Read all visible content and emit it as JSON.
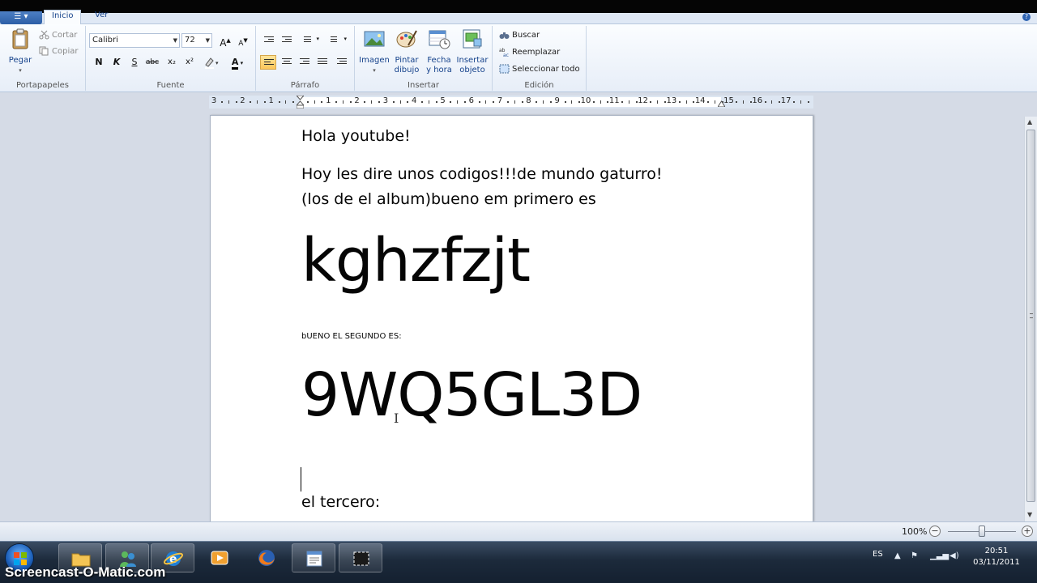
{
  "tabs": [
    {
      "label": "Inicio",
      "active": true
    },
    {
      "label": "Ver",
      "active": false
    }
  ],
  "clipboard": {
    "paste_label": "Pegar",
    "cut_label": "Cortar",
    "copy_label": "Copiar",
    "group_label": "Portapapeles"
  },
  "font": {
    "family": "Calibri",
    "size": "72",
    "bold": "N",
    "italic": "K",
    "underline": "S",
    "strike": "abc",
    "subscript": "x₂",
    "superscript": "x²",
    "color_letter": "A",
    "grow_letter": "A",
    "shrink_letter": "A",
    "group_label": "Fuente"
  },
  "paragraph": {
    "group_label": "Párrafo"
  },
  "insert": {
    "image_label": "Imagen",
    "paint_label": "Pintar dibujo",
    "paint_line1": "Pintar",
    "paint_line2": "dibujo",
    "date_line1": "Fecha",
    "date_line2": "y hora",
    "object_line1": "Insertar",
    "object_line2": "objeto",
    "group_label": "Insertar"
  },
  "editing": {
    "find_label": "Buscar",
    "replace_label": "Reemplazar",
    "select_all_label": "Seleccionar todo",
    "group_label": "Edición"
  },
  "ruler": {
    "labels": [
      "3",
      "2",
      "1",
      "1",
      "2",
      "3",
      "4",
      "5",
      "6",
      "7",
      "8",
      "9",
      "10",
      "11",
      "12",
      "13",
      "14",
      "15",
      "16",
      "17"
    ]
  },
  "document": {
    "line1": "Hola youtube!",
    "line2": "Hoy les dire unos codigos!!!de mundo gaturro!",
    "line3": "(los de el album)bueno em primero es",
    "code1": "kghzfzjt",
    "line4": "bUENO EL SEGUNDO ES:",
    "code2": "9WQ5GL3D",
    "line5": "el tercero:"
  },
  "status": {
    "zoom": "100%",
    "zoom_fraction": 0.5
  },
  "taskbar": {
    "lang": "ES",
    "time": "20:51",
    "date": "03/11/2011"
  },
  "watermark": "Screencast-O-Matic.com",
  "colors": {
    "accent": "#2b579a",
    "selected": "#fbc65a"
  }
}
